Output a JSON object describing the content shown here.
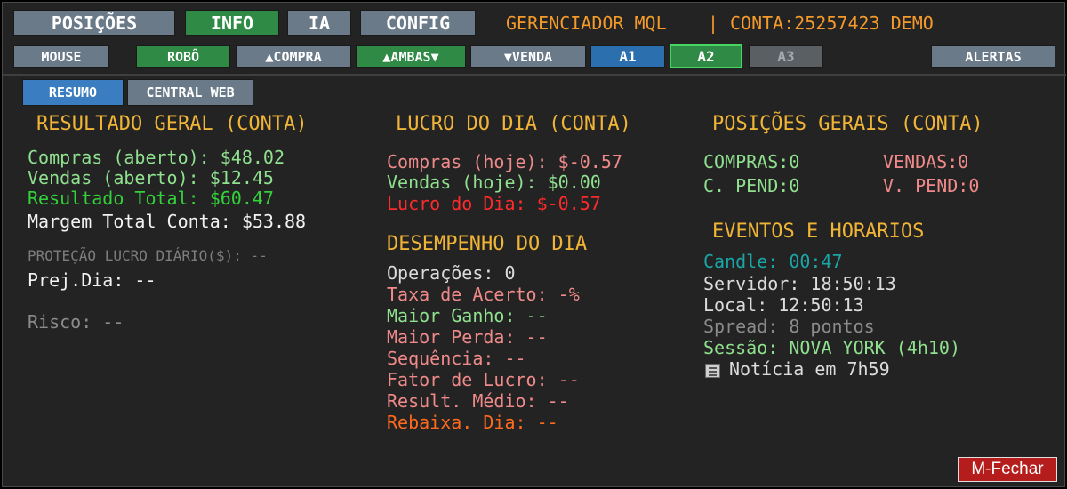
{
  "top_tabs": {
    "positions": "POSIÇÕES",
    "info": "INFO",
    "ia": "IA",
    "config": "CONFIG"
  },
  "header": {
    "title": "GERENCIADOR MQL",
    "separator": "|",
    "account": "CONTA:25257423 DEMO"
  },
  "toolbar": {
    "mouse": "MOUSE",
    "robot": "ROBÔ",
    "buy": "▲COMPRA",
    "both": "▲AMBAS▼",
    "sell": "▼VENDA",
    "a1": "A1",
    "a2": "A2",
    "a3": "A3",
    "alerts": "ALERTAS"
  },
  "subtabs": {
    "summary": "RESUMO",
    "central_web": "CENTRAL WEB"
  },
  "resultado_geral": {
    "title": "RESULTADO GERAL (CONTA)",
    "compras": "Compras (aberto): $48.02",
    "vendas": "Vendas (aberto): $12.45",
    "total": "Resultado Total: $60.47",
    "margem": "Margem Total Conta: $53.88",
    "protecao": "PROTEÇÃO LUCRO DIÁRIO($): --",
    "prej": "Prej.Dia: --",
    "risco": "Risco: --"
  },
  "lucro_dia": {
    "title": "LUCRO DO DIA (CONTA)",
    "compras": "Compras (hoje): $-0.57",
    "vendas": "Vendas (hoje): $0.00",
    "lucro": "Lucro do Dia: $-0.57"
  },
  "desempenho": {
    "title": "DESEMPENHO DO DIA",
    "operacoes": "Operações: 0",
    "taxa": "Taxa de Acerto: -%",
    "maior_ganho": "Maior Ganho: --",
    "maior_perda": "Maior Perda: --",
    "sequencia": "Sequência: --",
    "fator": "Fator de Lucro: --",
    "result_medio": "Result. Médio: --",
    "rebaixa": "Rebaixa. Dia: --"
  },
  "posicoes_gerais": {
    "title": "POSIÇÕES GERAIS (CONTA)",
    "compras": "COMPRAS:0",
    "vendas": "VENDAS:0",
    "c_pend": "C. PEND:0",
    "v_pend": "V. PEND:0"
  },
  "eventos": {
    "title": "EVENTOS E HORARIOS",
    "candle_label": "Candle:",
    "candle_value": "00:47",
    "servidor": "Servidor: 18:50:13",
    "local": "Local: 12:50:13",
    "spread": "Spread: 8 pontos",
    "sessao": "Sessão: NOVA YORK (4h10)",
    "noticia": "Notícia em 7h59"
  },
  "footer": {
    "close": "M-Fechar"
  },
  "icons": {
    "news": "news-icon"
  }
}
